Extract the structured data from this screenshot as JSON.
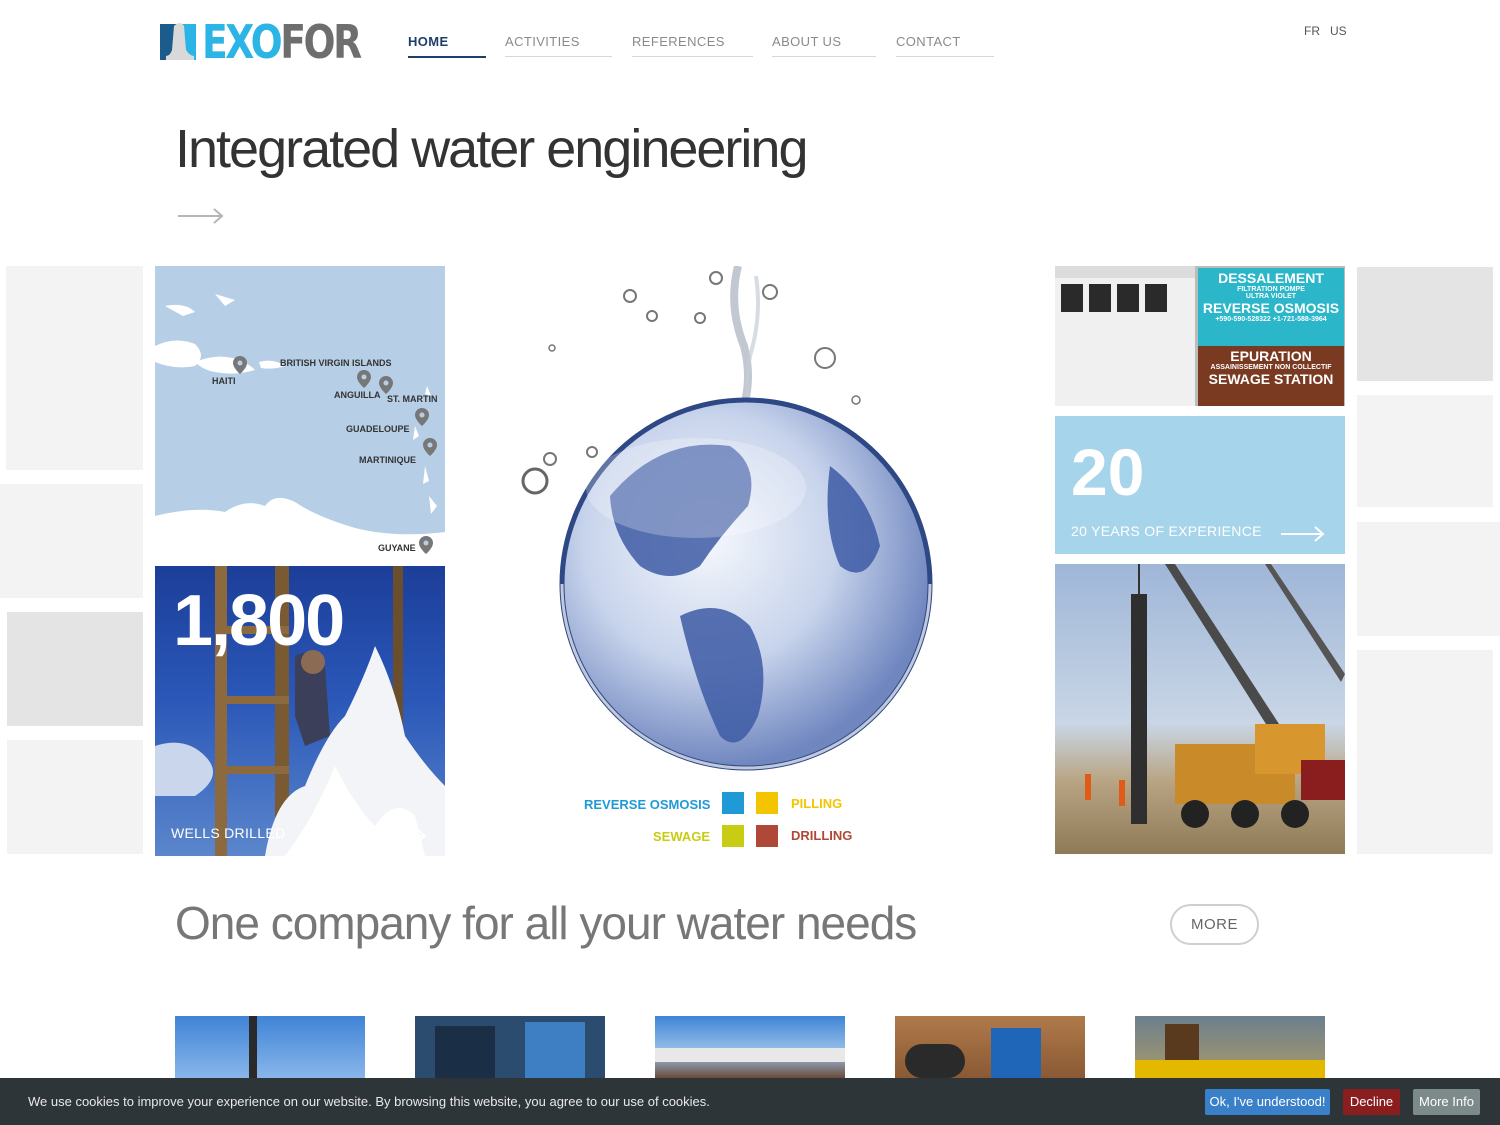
{
  "brand": {
    "name_part1": "EXO",
    "name_part2": "FOR",
    "primary_color": "#2bb4e6",
    "secondary_color": "#6e6e6e"
  },
  "nav": {
    "items": [
      {
        "label": "HOME",
        "active": true
      },
      {
        "label": "ACTIVITIES",
        "active": false
      },
      {
        "label": "REFERENCES",
        "active": false
      },
      {
        "label": "ABOUT US",
        "active": false
      },
      {
        "label": "CONTACT",
        "active": false
      }
    ],
    "languages": [
      "FR",
      "US"
    ]
  },
  "hero": {
    "title": "Integrated water engineering"
  },
  "map_tile": {
    "labels": [
      "HAITI",
      "BRITISH VIRGIN ISLANDS",
      "ANGUILLA",
      "ST. MARTIN",
      "GUADELOUPE",
      "MARTINIQUE",
      "GUYANE"
    ]
  },
  "wells_tile": {
    "number": "1,800",
    "label": "WELLS DRILLED"
  },
  "globe_legend": [
    {
      "label": "REVERSE OSMOSIS",
      "color": "#1f9ad6"
    },
    {
      "label": "PILLING",
      "color": "#f2c500"
    },
    {
      "label": "SEWAGE",
      "color": "#c8cc12"
    },
    {
      "label": "DRILLING",
      "color": "#b0483a"
    }
  ],
  "sign_tile": {
    "lines": [
      "DESSALEMENT",
      "FILTRATION",
      "POMPE",
      "ULTRA VIOLET",
      "REVERSE OSMOSIS",
      "+590-590-528322",
      "+1-721-588-3964",
      "EPURATION",
      "ASSAINISSEMENT NON COLLECTIF",
      "SEWAGE STATION"
    ]
  },
  "experience_tile": {
    "number": "20",
    "label": "20 YEARS OF EXPERIENCE",
    "color": "#a6d4ea"
  },
  "section": {
    "title": "One company for all your water needs",
    "more_label": "MORE"
  },
  "cookie": {
    "text": "We use cookies to improve your experience on our website. By browsing this website, you agree to our use of cookies.",
    "ok_label": "Ok, I've understood!",
    "decline_label": "Decline",
    "more_label": "More Info"
  }
}
